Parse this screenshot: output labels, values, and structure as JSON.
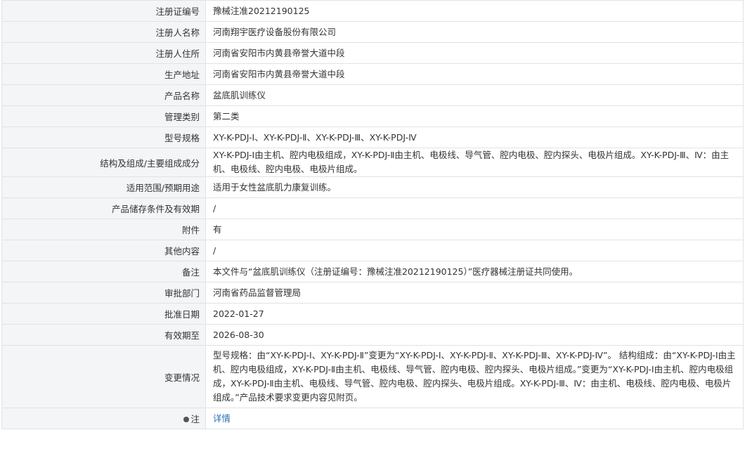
{
  "rows": [
    {
      "label": "注册证编号",
      "value": "豫械注准20212190125"
    },
    {
      "label": "注册人名称",
      "value": "河南翔宇医疗设备股份有限公司"
    },
    {
      "label": "注册人住所",
      "value": "河南省安阳市内黄县帝誉大道中段"
    },
    {
      "label": "生产地址",
      "value": "河南省安阳市内黄县帝誉大道中段"
    },
    {
      "label": "产品名称",
      "value": "盆底肌训练仪"
    },
    {
      "label": "管理类别",
      "value": "第二类"
    },
    {
      "label": "型号规格",
      "value": "XY-K-PDJ-Ⅰ、XY-K-PDJ-Ⅱ、XY-K-PDJ-Ⅲ、XY-K-PDJ-Ⅳ"
    },
    {
      "label": "结构及组成/主要组成成分",
      "value": "XY-K-PDJ-Ⅰ由主机、腔内电极组成，XY-K-PDJ-Ⅱ由主机、电极线、导气管、腔内电极、腔内探头、电极片组成。XY-K-PDJ-Ⅲ、Ⅳ：由主机、电极线、腔内电极、电极片组成。"
    },
    {
      "label": "适用范围/预期用途",
      "value": "适用于女性盆底肌力康复训练。"
    },
    {
      "label": "产品储存条件及有效期",
      "value": "/"
    },
    {
      "label": "附件",
      "value": "有"
    },
    {
      "label": "其他内容",
      "value": "/"
    },
    {
      "label": "备注",
      "value": "本文件与“盆底肌训练仪（注册证编号：豫械注准20212190125）”医疗器械注册证共同使用。"
    },
    {
      "label": "审批部门",
      "value": "河南省药品监督管理局"
    },
    {
      "label": "批准日期",
      "value": "2022-01-27"
    },
    {
      "label": "有效期至",
      "value": "2026-08-30"
    },
    {
      "label": "变更情况",
      "value": "型号规格：由“XY-K-PDJ-Ⅰ、XY-K-PDJ-Ⅱ”变更为“XY-K-PDJ-Ⅰ、XY-K-PDJ-Ⅱ、XY-K-PDJ-Ⅲ、XY-K-PDJ-Ⅳ”。 结构组成：由“XY-K-PDJ-Ⅰ由主机、腔内电极组成，XY-K-PDJ-Ⅱ由主机、电极线、导气管、腔内电极、腔内探头、电极片组成。”变更为“XY-K-PDJ-Ⅰ由主机、腔内电极组成，XY-K-PDJ-Ⅱ由主机、电极线、导气管、腔内电极、腔内探头、电极片组成。XY-K-PDJ-Ⅲ、Ⅳ：由主机、电极线、腔内电极、电极片组成。”产品技术要求变更内容见附页。"
    }
  ],
  "footer": {
    "label": "注",
    "link": "详情",
    "icon": "lightbulb-icon"
  }
}
